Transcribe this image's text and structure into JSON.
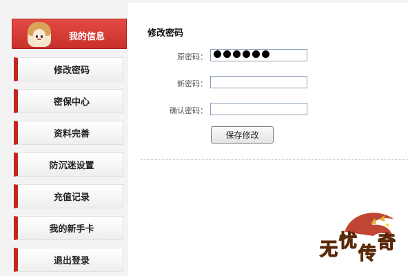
{
  "sidebar": {
    "profile_label": "我的信息",
    "items": [
      {
        "label": "修改密码"
      },
      {
        "label": "密保中心"
      },
      {
        "label": "资料完善"
      },
      {
        "label": "防沉迷设置"
      },
      {
        "label": "充值记录"
      },
      {
        "label": "我的新手卡"
      },
      {
        "label": "退出登录"
      }
    ]
  },
  "main": {
    "title": "修改密码",
    "form": {
      "old_password_label": "原密码：",
      "old_password_value": "●●●●●●",
      "new_password_label": "新密码：",
      "new_password_value": "",
      "confirm_password_label": "确认密码：",
      "confirm_password_value": ""
    },
    "save_button_label": "保存修改"
  },
  "logo": {
    "text": "无忧传奇",
    "icon": "dragon-logo"
  },
  "colors": {
    "accent_red": "#c2261f",
    "header_red": "#e24a43",
    "background": "#f3f3f3",
    "panel": "#ffffff"
  }
}
